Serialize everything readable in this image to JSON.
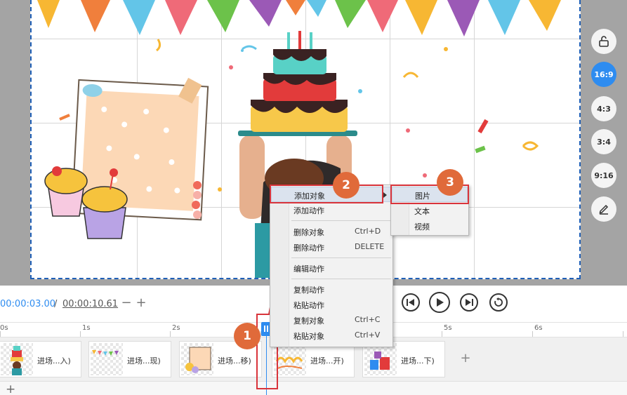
{
  "ratio_rail": {
    "lock_icon": "unlock-icon",
    "ratios": [
      "16:9",
      "4:3",
      "3:4",
      "9:16"
    ],
    "active": "16:9",
    "edit_icon": "pencil-icon"
  },
  "context_menu": {
    "items": [
      {
        "label": "添加对象",
        "shortcut": "",
        "has_submenu": true,
        "highlighted": true
      },
      {
        "label": "添加动作",
        "shortcut": ""
      },
      {
        "label": "删除对象",
        "shortcut": "Ctrl+D"
      },
      {
        "label": "删除动作",
        "shortcut": "DELETE"
      },
      {
        "label": "编辑动作",
        "shortcut": ""
      },
      {
        "label": "复制动作",
        "shortcut": ""
      },
      {
        "label": "粘贴动作",
        "shortcut": ""
      },
      {
        "label": "复制对象",
        "shortcut": "Ctrl+C"
      },
      {
        "label": "粘贴对象",
        "shortcut": "Ctrl+V"
      }
    ]
  },
  "submenu": {
    "items": [
      {
        "label": "图片",
        "highlighted": true
      },
      {
        "label": "文本"
      },
      {
        "label": "视频"
      }
    ]
  },
  "annotations": {
    "badge_1": "1",
    "badge_2": "2",
    "badge_3": "3",
    "accent_color": "#d9343b",
    "badge_color": "#e06a3a"
  },
  "playback": {
    "current_time": "00:00:03.00",
    "separator": "/",
    "total_time": "00:00:10.61",
    "zoom_out": "−",
    "zoom_in": "+",
    "controls": [
      "skip-back-icon",
      "play-icon",
      "skip-forward-icon",
      "replay-icon"
    ]
  },
  "ruler": {
    "labels": [
      "0s",
      "1s",
      "2s",
      "5s",
      "6s"
    ]
  },
  "timeline": {
    "clips": [
      {
        "label": "进场...入)"
      },
      {
        "label": "进场...现)"
      },
      {
        "label": "进场...移)"
      },
      {
        "label": "进场...开)"
      },
      {
        "label": "进场...下)"
      }
    ],
    "add_clip": "+",
    "add_track": "+"
  },
  "colors": {
    "accent_blue": "#2e8cf0",
    "stage_gray": "#a4a4a4"
  }
}
